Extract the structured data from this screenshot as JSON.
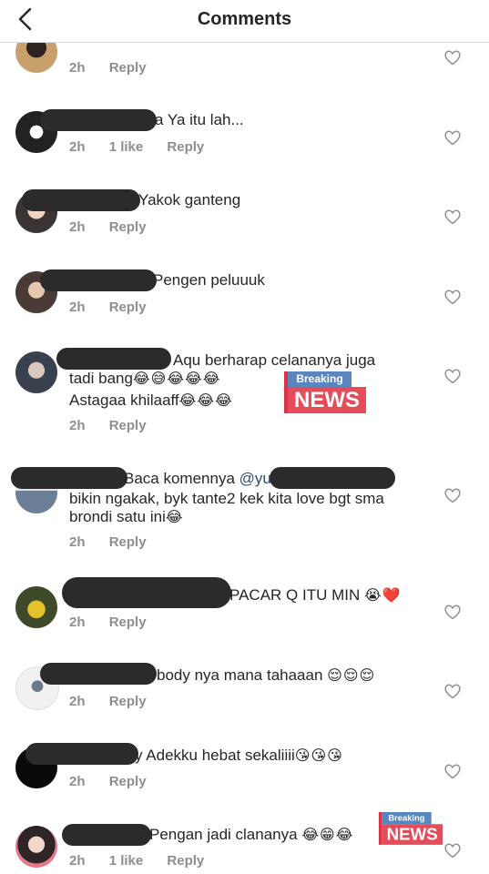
{
  "header": {
    "title": "Comments"
  },
  "comments": [
    {
      "text": "",
      "time": "2h",
      "likes": "",
      "reply": "Reply"
    },
    {
      "text": "a Ya itu lah...",
      "time": "2h",
      "likes": "1 like",
      "reply": "Reply"
    },
    {
      "text": "Yakok ganteng",
      "time": "2h",
      "likes": "",
      "reply": "Reply"
    },
    {
      "text": "Pengen peluuuk",
      "time": "2h",
      "likes": "",
      "reply": "Reply"
    },
    {
      "line1": "Aqu berharap celananya juga",
      "line2": "tadi bang",
      "line2_emoji": "😂😅😂😂😂",
      "line3": "Astagaa khilaaff",
      "line3_emoji": "😂😂😂",
      "time": "2h",
      "likes": "",
      "reply": "Reply",
      "badge": {
        "top": "Breaking",
        "bottom": "NEWS"
      }
    },
    {
      "line1": "Baca komennya ",
      "mention": "@yu",
      "line2": "bikin ngakak, byk tante2 kek kita love bgt sma",
      "line3": "brondi satu ini",
      "line3_emoji": "😂",
      "time": "2h",
      "likes": "",
      "reply": "Reply"
    },
    {
      "text": "PACAR Q ITU MIN",
      "emoji": "😭❤️",
      "time": "2h",
      "likes": "",
      "reply": "Reply"
    },
    {
      "text": "body nya mana tahaaan",
      "emoji": "😌😌😌",
      "time": "2h",
      "likes": "",
      "reply": "Reply"
    },
    {
      "text": "y Adekku hebat sekaliiii",
      "emoji": "😘😘😘",
      "time": "2h",
      "likes": "",
      "reply": "Reply"
    },
    {
      "text": "Pengan jadi clananya",
      "emoji": "😂😁😂",
      "time": "2h",
      "likes": "1 like",
      "reply": "Reply",
      "badge": {
        "top": "Breaking",
        "bottom": "NEWS"
      }
    }
  ]
}
